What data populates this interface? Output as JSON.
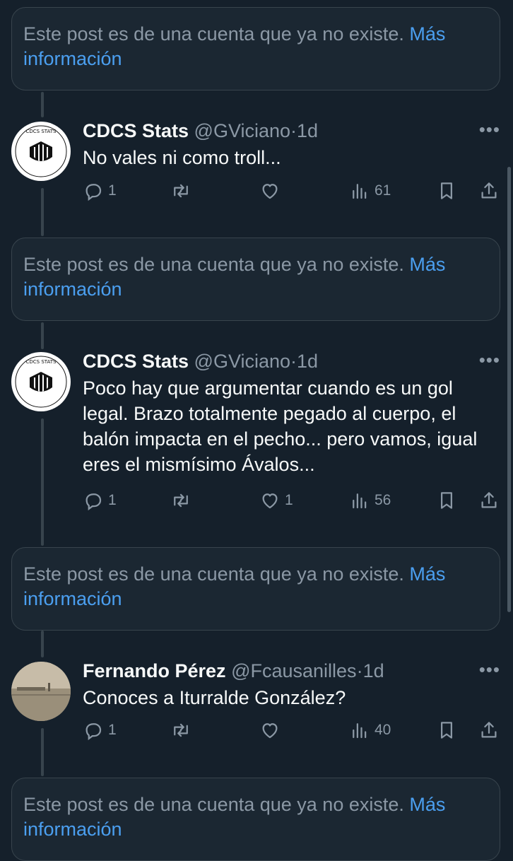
{
  "deleted_notice": {
    "text": "Este post es de una cuenta que ya no existe.",
    "more_label": "Más",
    "more_label_2": "información"
  },
  "posts": [
    {
      "name": "CDCS Stats",
      "handle": "@GViciano",
      "dot": "·",
      "time": "1d",
      "text": "No vales ni como troll...",
      "replies": "1",
      "reposts": "",
      "likes": "",
      "views": "61",
      "avatar_text": "CDCS STATS"
    },
    {
      "name": "CDCS Stats",
      "handle": "@GViciano",
      "dot": "·",
      "time": "1d",
      "text": "Poco hay que argumentar cuando es un gol legal. Brazo totalmente pegado al cuerpo, el balón impacta en el pecho... pero vamos, igual eres el mismísimo Ávalos...",
      "replies": "1",
      "reposts": "",
      "likes": "1",
      "views": "56",
      "avatar_text": "CDCS STATS"
    },
    {
      "name": "Fernando Pérez",
      "handle": "@Fcausanilles",
      "dot": "·",
      "time": "1d",
      "text": "Conoces a Iturralde González?",
      "replies": "1",
      "reposts": "",
      "likes": "",
      "views": "40"
    }
  ],
  "icons": {
    "more": "more-horizontal-icon",
    "reply": "reply-icon",
    "repost": "repost-icon",
    "like": "heart-icon",
    "views": "views-icon",
    "bookmark": "bookmark-icon",
    "share": "share-icon"
  },
  "colors": {
    "background": "#15202b",
    "card": "#1b2732",
    "border": "#38444d",
    "secondary_text": "#8b98a5",
    "link": "#4b9ff0"
  }
}
